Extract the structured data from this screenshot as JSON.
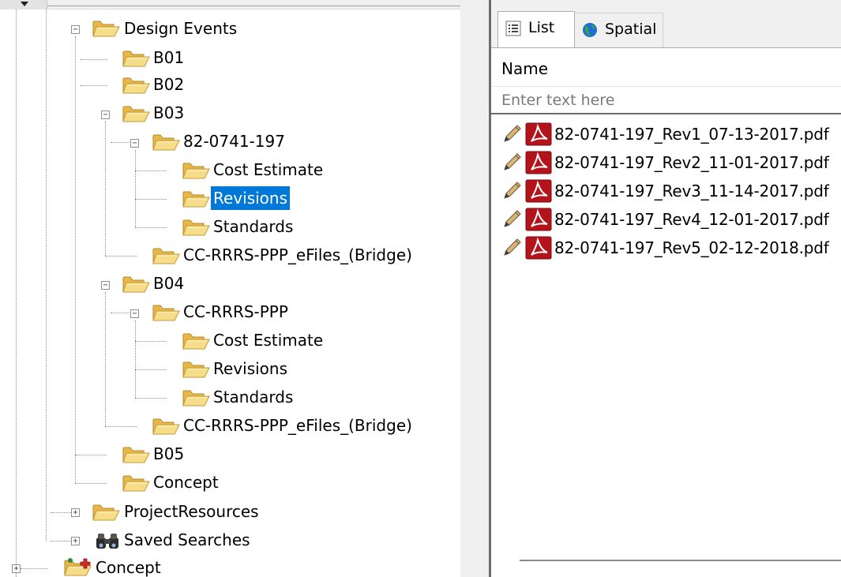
{
  "tree": {
    "nodes": {
      "design_events": "Design Events",
      "b01": "B01",
      "b02": "B02",
      "b03": "B03",
      "b03_sub": "82-0741-197",
      "b03_cost": "Cost Estimate",
      "b03_revisions": "Revisions",
      "b03_standards": "Standards",
      "b03_efiles": "CC-RRRS-PPP_eFiles_(Bridge)",
      "b04": "B04",
      "b04_sub": "CC-RRRS-PPP",
      "b04_cost": "Cost Estimate",
      "b04_revisions": "Revisions",
      "b04_standards": "Standards",
      "b04_efiles": "CC-RRRS-PPP_eFiles_(Bridge)",
      "b05": "B05",
      "concept_inner": "Concept",
      "project_resources": "ProjectResources",
      "saved_searches": "Saved Searches",
      "concept_root": "Concept"
    },
    "selected": "Revisions"
  },
  "tabs": {
    "list_label": "List",
    "spatial_label": "Spatial",
    "active": "List"
  },
  "list": {
    "column_header": "Name",
    "filter_placeholder": "Enter text here",
    "files": [
      "82-0741-197_Rev1_07-13-2017.pdf",
      "82-0741-197_Rev2_11-01-2017.pdf",
      "82-0741-197_Rev3_11-14-2017.pdf",
      "82-0741-197_Rev4_12-01-2017.pdf",
      "82-0741-197_Rev5_02-12-2018.pdf"
    ]
  },
  "icons": {
    "folder": "folder-open-icon",
    "binoculars": "binoculars-icon",
    "concept_root": "folder-concept-icon",
    "pencil": "pencil-icon",
    "pdf": "pdf-icon",
    "list_tab": "list-view-icon",
    "spatial_tab": "globe-icon"
  },
  "colors": {
    "selection": "#0078d7",
    "folder_fill": "#f6d77c",
    "pdf_red": "#b3141c"
  }
}
